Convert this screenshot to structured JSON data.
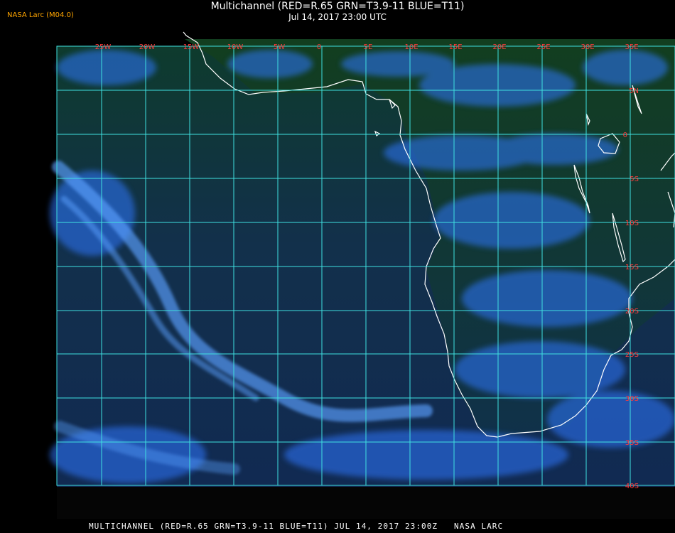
{
  "app": {
    "corner_label": "NASA Larc (M04.0)",
    "title_line1": "Multichannel (RED=R.65 GRN=T3.9-11 BLUE=T11)",
    "title_line2": "Jul 14, 2017 23:00 UTC",
    "footer": "MULTICHANNEL (RED=R.65 GRN=T3.9-11 BLUE=T11) JUL 14, 2017 23:00Z   NASA LARC"
  },
  "map": {
    "longitude_labels": [
      "25W",
      "20W",
      "15W",
      "10W",
      "5W",
      "0",
      "5E",
      "10E",
      "15E",
      "20E",
      "25E",
      "30E",
      "35E"
    ],
    "latitude_labels": [
      "5N",
      "0",
      "5S",
      "10S",
      "15S",
      "20S",
      "25S",
      "30S",
      "35S",
      "40S"
    ],
    "colors": {
      "grid": "#3fe0e0",
      "label": "#ff3b3b",
      "coastline": "#ffffff",
      "land": "#123a22",
      "ocean_top": "#0f3f2c",
      "cloud": "#3f86ff"
    }
  }
}
